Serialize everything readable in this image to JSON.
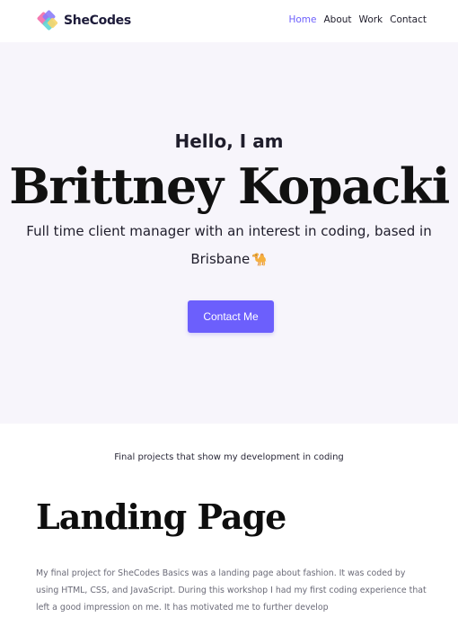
{
  "navbar": {
    "brand": "SheCodes",
    "logo_icon": "shecodes-logo-icon",
    "links": [
      {
        "label": "Home",
        "active": true
      },
      {
        "label": "About",
        "active": false
      },
      {
        "label": "Work",
        "active": false
      },
      {
        "label": "Contact",
        "active": false
      }
    ]
  },
  "hero": {
    "greeting": "Hello, I am",
    "name": "Brittney Kopacki",
    "tagline": "Full time client manager with an interest in coding, based in Brisbane",
    "tagline_icon": "camel-emoji",
    "cta_label": "Contact Me",
    "background": "#f7f5fb"
  },
  "projects": {
    "intro": "Final projects that show my development in coding",
    "items": [
      {
        "title": "Landing Page",
        "description": "My final project for SheCodes Basics was a landing page about fashion. It was coded by using HTML, CSS, and JavaScript. During this workshop I had my first coding experience that left a good impression on me. It has motivated me to further develop"
      }
    ]
  },
  "colors": {
    "accent": "#6c5ffc",
    "text": "#1f1d2b",
    "muted_text": "#6b6b78"
  }
}
